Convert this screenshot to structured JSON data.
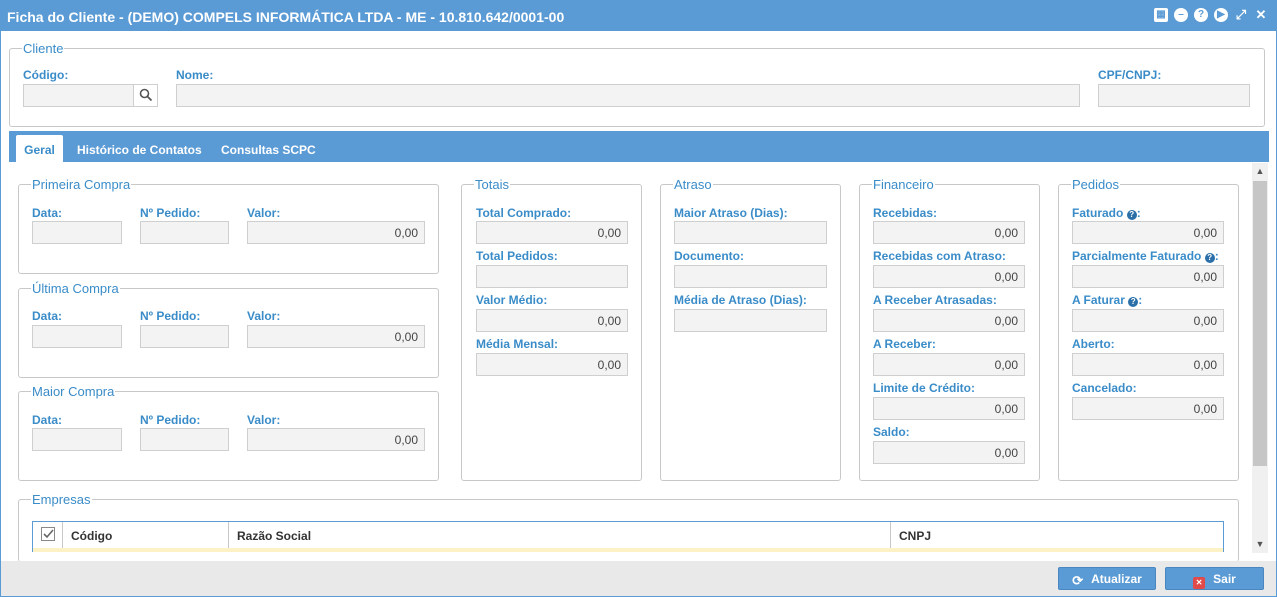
{
  "window": {
    "title": "Ficha do Cliente - (DEMO) COMPELS INFORMÁTICA LTDA - ME - 10.810.642/0001-00",
    "icons": [
      "calendar-icon",
      "minimize-icon",
      "help-icon",
      "play-icon",
      "maximize-icon",
      "close-icon"
    ]
  },
  "cliente": {
    "legend": "Cliente",
    "codigo_label": "Código:",
    "codigo_value": "",
    "nome_label": "Nome:",
    "nome_value": "",
    "cpf_label": "CPF/CNPJ:",
    "cpf_value": ""
  },
  "tabs": [
    {
      "label": "Geral"
    },
    {
      "label": "Histórico de Contatos"
    },
    {
      "label": "Consultas SCPC"
    }
  ],
  "primeira_compra": {
    "legend": "Primeira Compra",
    "data_label": "Data:",
    "pedido_label": "Nº Pedido:",
    "valor_label": "Valor:",
    "data": "",
    "pedido": "",
    "valor": "0,00"
  },
  "ultima_compra": {
    "legend": "Última Compra",
    "data_label": "Data:",
    "pedido_label": "Nº Pedido:",
    "valor_label": "Valor:",
    "data": "",
    "pedido": "",
    "valor": "0,00"
  },
  "maior_compra": {
    "legend": "Maior Compra",
    "data_label": "Data:",
    "pedido_label": "Nº Pedido:",
    "valor_label": "Valor:",
    "data": "",
    "pedido": "",
    "valor": "0,00"
  },
  "totais": {
    "legend": "Totais",
    "fields": [
      {
        "label": "Total Comprado:",
        "value": "0,00"
      },
      {
        "label": "Total Pedidos:",
        "value": ""
      },
      {
        "label": "Valor Médio:",
        "value": "0,00"
      },
      {
        "label": "Média Mensal:",
        "value": "0,00"
      }
    ]
  },
  "atraso": {
    "legend": "Atraso",
    "fields": [
      {
        "label": "Maior Atraso (Dias):",
        "value": ""
      },
      {
        "label": "Documento:",
        "value": ""
      },
      {
        "label": "Média de Atraso (Dias):",
        "value": ""
      }
    ]
  },
  "financeiro": {
    "legend": "Financeiro",
    "fields": [
      {
        "label": "Recebidas:",
        "value": "0,00"
      },
      {
        "label": "Recebidas com Atraso:",
        "value": "0,00"
      },
      {
        "label": "A Receber Atrasadas:",
        "value": "0,00"
      },
      {
        "label": "A Receber:",
        "value": "0,00"
      },
      {
        "label": "Limite de Crédito:",
        "value": "0,00"
      },
      {
        "label": "Saldo:",
        "value": "0,00"
      }
    ]
  },
  "pedidos": {
    "legend": "Pedidos",
    "fields": [
      {
        "label": "Faturado",
        "value": "0,00",
        "has_help": true
      },
      {
        "label": "Parcialmente Faturado",
        "value": "0,00",
        "has_help": true
      },
      {
        "label": "A Faturar",
        "value": "0,00",
        "has_help": true
      },
      {
        "label": "Aberto:",
        "value": "0,00",
        "has_help": false
      },
      {
        "label": "Cancelado:",
        "value": "0,00",
        "has_help": false
      }
    ],
    "help_suffix": ":"
  },
  "empresas": {
    "legend": "Empresas",
    "columns": [
      "Código",
      "Razão Social",
      "CNPJ"
    ]
  },
  "footer": {
    "atualizar_label": "Atualizar",
    "sair_label": "Sair"
  },
  "colors": {
    "accent": "#5b9bd5",
    "label": "#3a8cc8",
    "sair_icon": "#e04a4a"
  }
}
